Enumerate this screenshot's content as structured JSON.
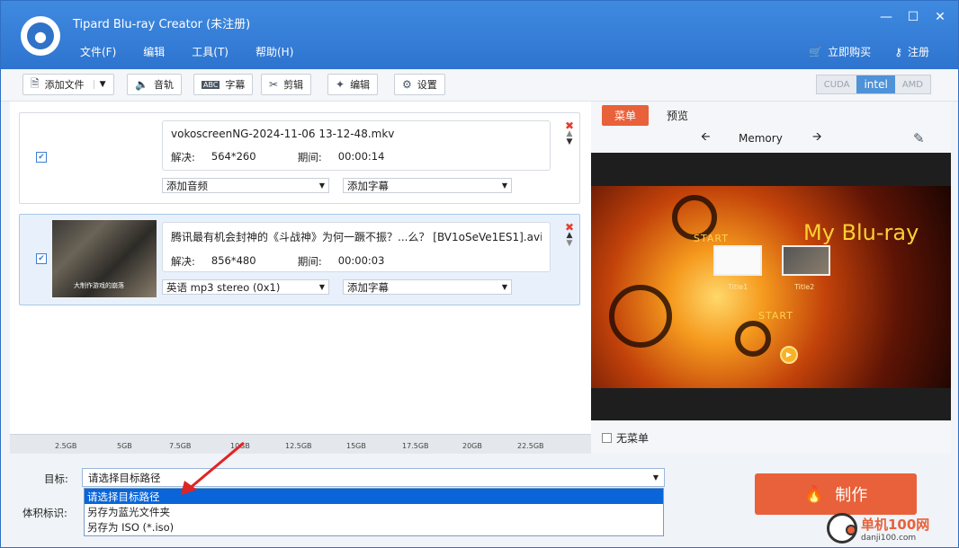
{
  "window": {
    "title": "Tipard Blu-ray Creator (未注册)",
    "controls": [
      "—",
      "☐",
      "✕"
    ]
  },
  "menu": [
    "文件(F)",
    "编辑",
    "工具(T)",
    "帮助(H)"
  ],
  "top_links": {
    "buy": "立即购买",
    "register": "注册"
  },
  "toolbar": {
    "add_file": "添加文件",
    "audio": "音轨",
    "subtitle": "字幕",
    "clip": "剪辑",
    "edit": "编辑",
    "settings": "设置",
    "subtitle_icon_text": "ABC",
    "accel": {
      "cuda": "CUDA",
      "intel": "intel",
      "amd": "AMD"
    }
  },
  "files": [
    {
      "name": "vokoscreenNG-2024-11-06 13-12-48.mkv",
      "res_label": "解决:",
      "res": "564*260",
      "dur_label": "期间:",
      "dur": "00:00:14",
      "audio": "添加音频",
      "subtitle": "添加字幕",
      "checked": true
    },
    {
      "name": "腾讯最有机会封神的《斗战神》为何一蹶不振？...么？  [BV1oSeVe1ES1].avi",
      "res_label": "解决:",
      "res": "856*480",
      "dur_label": "期间:",
      "dur": "00:00:03",
      "audio": "英语 mp3 stereo (0x1)",
      "subtitle": "添加字幕",
      "checked": true,
      "thumb_caption": "大制作游戏的崩落"
    }
  ],
  "ruler": [
    "2.5GB",
    "5GB",
    "7.5GB",
    "10GB",
    "12.5GB",
    "15GB",
    "17.5GB",
    "20GB",
    "22.5GB"
  ],
  "right": {
    "tab_menu": "菜单",
    "tab_preview": "预览",
    "template_name": "Memory",
    "menu_title": "My Blu-ray",
    "start1": "START",
    "start2": "START",
    "title1": "Title1",
    "title2": "Title2",
    "no_menu": "无菜单"
  },
  "bottom": {
    "target_label": "目标:",
    "target_value": "请选择目标路径",
    "size_label": "体积标识:",
    "options": [
      "请选择目标路径",
      "另存为蓝光文件夹",
      "另存为 ISO (*.iso)"
    ],
    "make": "制作"
  },
  "watermark": {
    "main": "单机100网",
    "sub": "danji100.com"
  },
  "colors": {
    "accent": "#e8613a",
    "titlebar": "#3f8ae0",
    "highlight": "#0a65d8"
  }
}
